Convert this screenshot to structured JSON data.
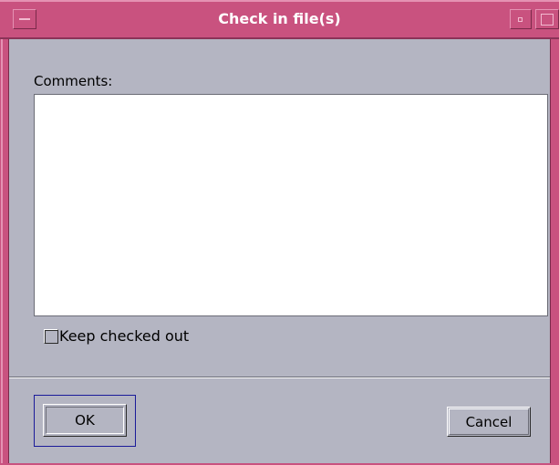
{
  "window": {
    "title": "Check in file(s)"
  },
  "form": {
    "comments_label": "Comments:",
    "comments_value": "",
    "keep_checked_out_label": "Keep checked out",
    "keep_checked_out_checked": false
  },
  "buttons": {
    "ok_label": "OK",
    "cancel_label": "Cancel"
  },
  "colors": {
    "frame": "#c9527f",
    "dialog_background": "#b4b5c2",
    "focus_ring": "#1a1a99"
  },
  "icons": {
    "window_menu": "window-menu-icon",
    "minimize": "minimize-icon",
    "maximize": "maximize-icon"
  }
}
